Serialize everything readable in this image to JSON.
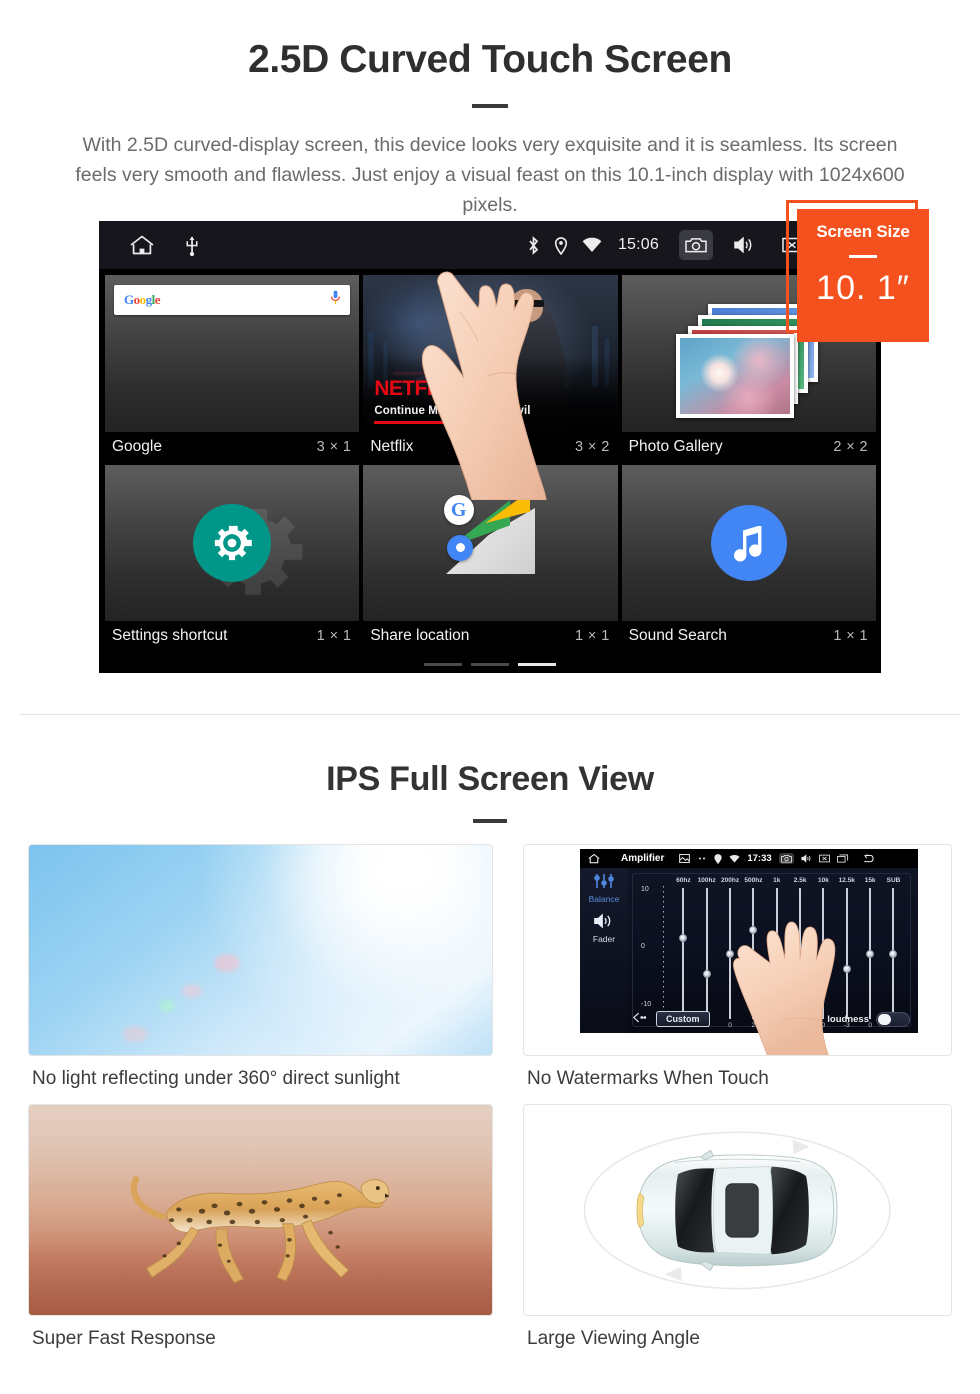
{
  "section1": {
    "title": "2.5D Curved Touch Screen",
    "description": "With 2.5D curved-display screen, this device looks very exquisite and it is seamless. Its screen feels very smooth and flawless. Just enjoy a visual feast on this 10.1-inch display with 1024x600 pixels.",
    "badge": {
      "title": "Screen Size",
      "value": "10. 1″",
      "color": "#f4511e"
    },
    "device": {
      "statusbar": {
        "clock": "15:06",
        "left_icons": [
          "home-icon",
          "usb-icon"
        ],
        "right_icons": [
          "bluetooth-icon",
          "location-icon",
          "wifi-icon"
        ],
        "buttons": [
          "camera-icon",
          "volume-icon",
          "close-icon",
          "recents-icon"
        ]
      },
      "search": {
        "logo": "Google",
        "mic": "microphone-icon"
      },
      "netflix": {
        "brand": "NETFLIX",
        "continue": "Continue Marvel's Daredevil"
      },
      "widgets": [
        {
          "name": "Google",
          "size": "3 × 1"
        },
        {
          "name": "Netflix",
          "size": "3 × 2"
        },
        {
          "name": "Photo Gallery",
          "size": "2 × 2"
        },
        {
          "name": "Settings shortcut",
          "size": "1 × 1"
        },
        {
          "name": "Share location",
          "size": "1 × 1"
        },
        {
          "name": "Sound Search",
          "size": "1 × 1"
        }
      ],
      "page_dots": 3,
      "active_dot": 2
    }
  },
  "section2": {
    "title": "IPS Full Screen View",
    "cards": [
      {
        "caption": "No light reflecting under 360° direct sunlight",
        "media": "sunlight-photo"
      },
      {
        "caption": "No Watermarks When Touch",
        "media": "amplifier-screenshot"
      },
      {
        "caption": "Super Fast Response",
        "media": "cheetah-photo"
      },
      {
        "caption": "Large Viewing Angle",
        "media": "car-top-view"
      }
    ],
    "amplifier": {
      "title": "Amplifier",
      "clock": "17:33",
      "side_labels": [
        "Balance",
        "Fader"
      ],
      "scale": {
        "max": "10",
        "mid": "0",
        "min": "-10"
      },
      "bands": [
        {
          "hz": "60hz",
          "value": "3"
        },
        {
          "hz": "100hz",
          "value": "-4"
        },
        {
          "hz": "200hz",
          "value": "0"
        },
        {
          "hz": "500hz",
          "value": "2"
        },
        {
          "hz": "1k",
          "value": "0"
        },
        {
          "hz": "2.5k",
          "value": "-3"
        },
        {
          "hz": "10k",
          "value": "0"
        },
        {
          "hz": "12.5k",
          "value": "-3"
        },
        {
          "hz": "15k",
          "value": "0"
        },
        {
          "hz": "SUB",
          "value": "0"
        }
      ],
      "preset_button": "Custom",
      "loudness_label": "loudness",
      "loudness_on": false,
      "back_icon": "back-arrow-icon"
    }
  }
}
